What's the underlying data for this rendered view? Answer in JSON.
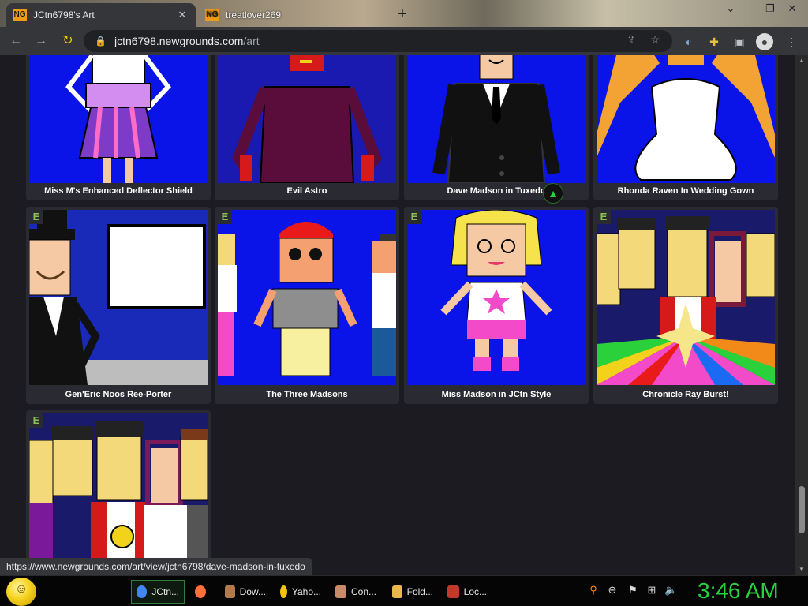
{
  "tabs": [
    {
      "label": "JCtn6798's Art",
      "favicon": "NG",
      "active": true
    },
    {
      "label": "treatlover269",
      "favicon": "NG",
      "active": false
    }
  ],
  "toolbar": {
    "url_host": "jctn6798.newgrounds.com",
    "url_path": "/art"
  },
  "artworks": [
    {
      "title": "Miss M's Enhanced Deflector Shield",
      "badge": ""
    },
    {
      "title": "Evil Astro",
      "badge": ""
    },
    {
      "title": "Dave Madson in Tuxedo",
      "badge": ""
    },
    {
      "title": "Rhonda Raven In Wedding Gown",
      "badge": ""
    },
    {
      "title": "Gen'Eric Noos Ree-Porter",
      "badge": "E"
    },
    {
      "title": "The Three Madsons",
      "badge": "E"
    },
    {
      "title": "Miss Madson in JCtn Style",
      "badge": "E"
    },
    {
      "title": "Chronicle Ray Burst!",
      "badge": "E"
    },
    {
      "title": "",
      "badge": "E"
    }
  ],
  "status_url": "https://www.newgrounds.com/art/view/jctn6798/dave-madson-in-tuxedo",
  "taskbar": {
    "apps": [
      {
        "label": "JCtn...",
        "color": "#4285f4"
      },
      {
        "label": "",
        "color": "#ff7139"
      },
      {
        "label": "Dow...",
        "color": "#b07a4a"
      },
      {
        "label": "Yaho...",
        "color": "#f2c40f"
      },
      {
        "label": "Con...",
        "color": "#c98a6a"
      },
      {
        "label": "Fold...",
        "color": "#e8b84a"
      },
      {
        "label": "Loc...",
        "color": "#c0392b"
      }
    ],
    "clock": "3:46 AM"
  },
  "colors": {
    "accent_green": "#29d13d",
    "badge_green": "#8ac250",
    "page_bg": "#1c1b22",
    "card_bg": "#2a2a33"
  }
}
